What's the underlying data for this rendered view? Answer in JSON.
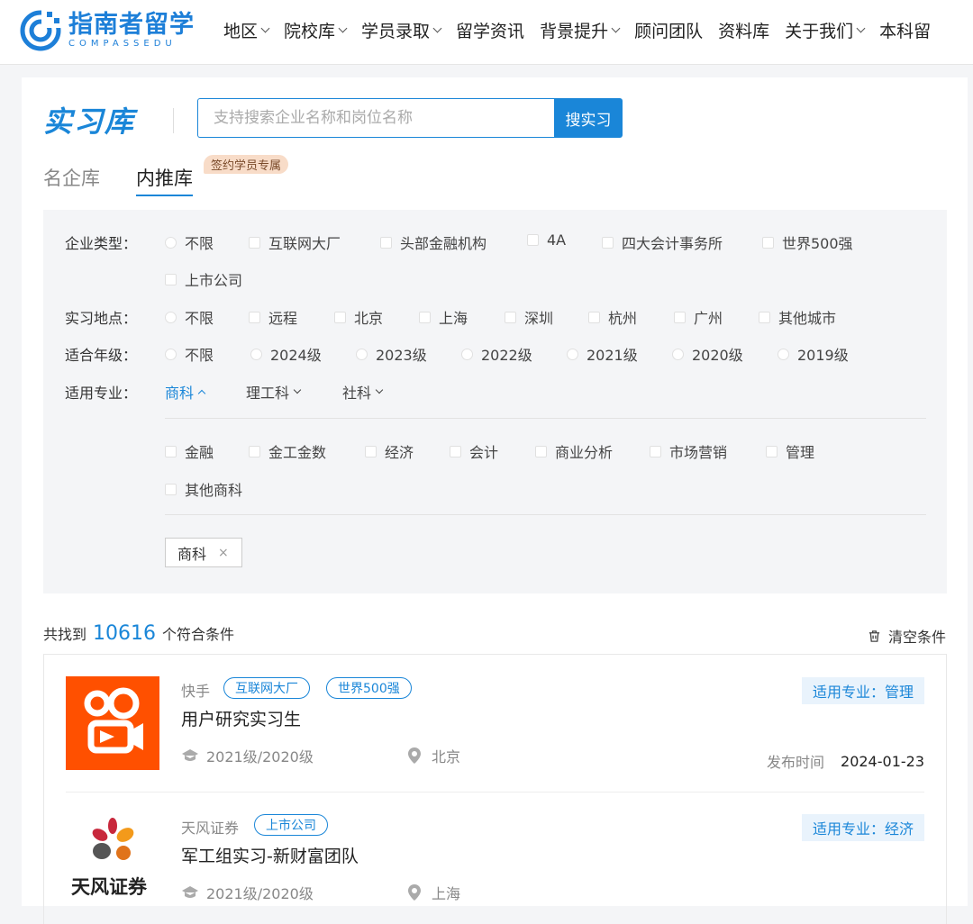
{
  "header": {
    "logo_cn": "指南者留学",
    "logo_en": "COMPASSEDU",
    "nav": [
      {
        "label": "地区",
        "dropdown": true
      },
      {
        "label": "院校库",
        "dropdown": true
      },
      {
        "label": "学员录取",
        "dropdown": true
      },
      {
        "label": "留学资讯",
        "dropdown": false
      },
      {
        "label": "背景提升",
        "dropdown": true
      },
      {
        "label": "顾问团队",
        "dropdown": false
      },
      {
        "label": "资料库",
        "dropdown": false
      },
      {
        "label": "关于我们",
        "dropdown": true
      },
      {
        "label": "本科留",
        "dropdown": false
      }
    ]
  },
  "page": {
    "brand": "实习库",
    "search_placeholder": "支持搜索企业名称和岗位名称",
    "search_button": "搜实习",
    "tabs": [
      {
        "label": "名企库",
        "active": false
      },
      {
        "label": "内推库",
        "active": true
      }
    ],
    "exclusive_badge": "签约学员专属"
  },
  "filters": {
    "company_type": {
      "label": "企业类型：",
      "options": [
        "不限",
        "互联网大厂",
        "头部金融机构",
        "4A",
        "四大会计事务所",
        "世界500强",
        "上市公司"
      ]
    },
    "location": {
      "label": "实习地点：",
      "options": [
        "不限",
        "远程",
        "北京",
        "上海",
        "深圳",
        "杭州",
        "广州",
        "其他城市"
      ]
    },
    "grade": {
      "label": "适合年级：",
      "options": [
        "不限",
        "2024级",
        "2023级",
        "2022级",
        "2021级",
        "2020级",
        "2019级"
      ]
    },
    "major": {
      "label": "适用专业：",
      "tabs": [
        {
          "label": "商科",
          "active": true
        },
        {
          "label": "理工科",
          "active": false
        },
        {
          "label": "社科",
          "active": false
        }
      ],
      "options": [
        "金融",
        "金工金数",
        "经济",
        "会计",
        "商业分析",
        "市场营销",
        "管理",
        "其他商科"
      ]
    },
    "selected_tag": "商科",
    "selected_tag_close": "×"
  },
  "results": {
    "prefix": "共找到",
    "count": "10616",
    "suffix": "个符合条件",
    "clear_label": "清空条件",
    "items": [
      {
        "company": "快手",
        "tags": [
          "互联网大厂",
          "世界500强"
        ],
        "title": "用户研究实习生",
        "grades": "2021级/2020级",
        "city": "北京",
        "major": "适用专业：管理",
        "date_label": "发布时间",
        "date": "2024-01-23"
      },
      {
        "company": "天风证券",
        "tags": [
          "上市公司"
        ],
        "title": "军工组实习-新财富团队",
        "grades": "2021级/2020级",
        "city": "上海",
        "major": "适用专业：经济",
        "logo_text": "天风证券"
      }
    ]
  },
  "colors": {
    "accent": "#1a86d8",
    "kuaishou": "#ff5000",
    "badge": "#f8dcc8"
  }
}
